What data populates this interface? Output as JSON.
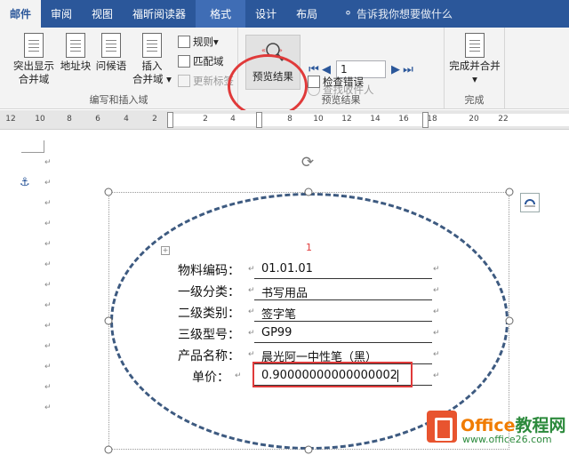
{
  "tabs": [
    "邮件",
    "审阅",
    "视图",
    "福昕阅读器",
    "格式",
    "设计",
    "布局"
  ],
  "tell_me": "告诉我你想要做什么",
  "ribbon": {
    "group_write": {
      "label": "编写和插入域",
      "highlight_merge_fields": [
        "突出显示",
        "合并域"
      ],
      "address_block": "地址块",
      "greeting_line": "问候语",
      "insert_merge_field": [
        "插入",
        "合并域"
      ],
      "rules": "规则",
      "match_fields": "匹配域",
      "update_labels": "更新标签"
    },
    "group_preview": {
      "label": "预览结果",
      "preview_results": "预览结果",
      "record_value": "1",
      "find_recipient": "查找收件人",
      "check_errors": "检查错误"
    },
    "group_finish": {
      "label": "完成",
      "finish_merge": "完成并合并"
    }
  },
  "ruler_ticks": [
    "12",
    "10",
    "8",
    "6",
    "4",
    "2",
    "2",
    "4",
    "8",
    "10",
    "12",
    "14",
    "16",
    "18",
    "20",
    "22"
  ],
  "document": {
    "page_number": "1",
    "rows": [
      {
        "label": "物料编码：",
        "value": "01.01.01"
      },
      {
        "label": "一级分类：",
        "value": "书写用品"
      },
      {
        "label": "二级类别：",
        "value": "签字笔"
      },
      {
        "label": "三级型号：",
        "value": "GP99"
      },
      {
        "label": "产品名称：",
        "value": "晨光阿一中性笔（黑）"
      },
      {
        "label": "单价：",
        "value": "0.90000000000000002"
      }
    ]
  },
  "watermark": {
    "brand": "Office",
    "brand_cn": "教程网",
    "url": "www.office26.com"
  },
  "colors": {
    "ribbon_blue": "#2b579a",
    "highlight_red": "#e03a3a",
    "shape_dash": "#3d5a80"
  }
}
